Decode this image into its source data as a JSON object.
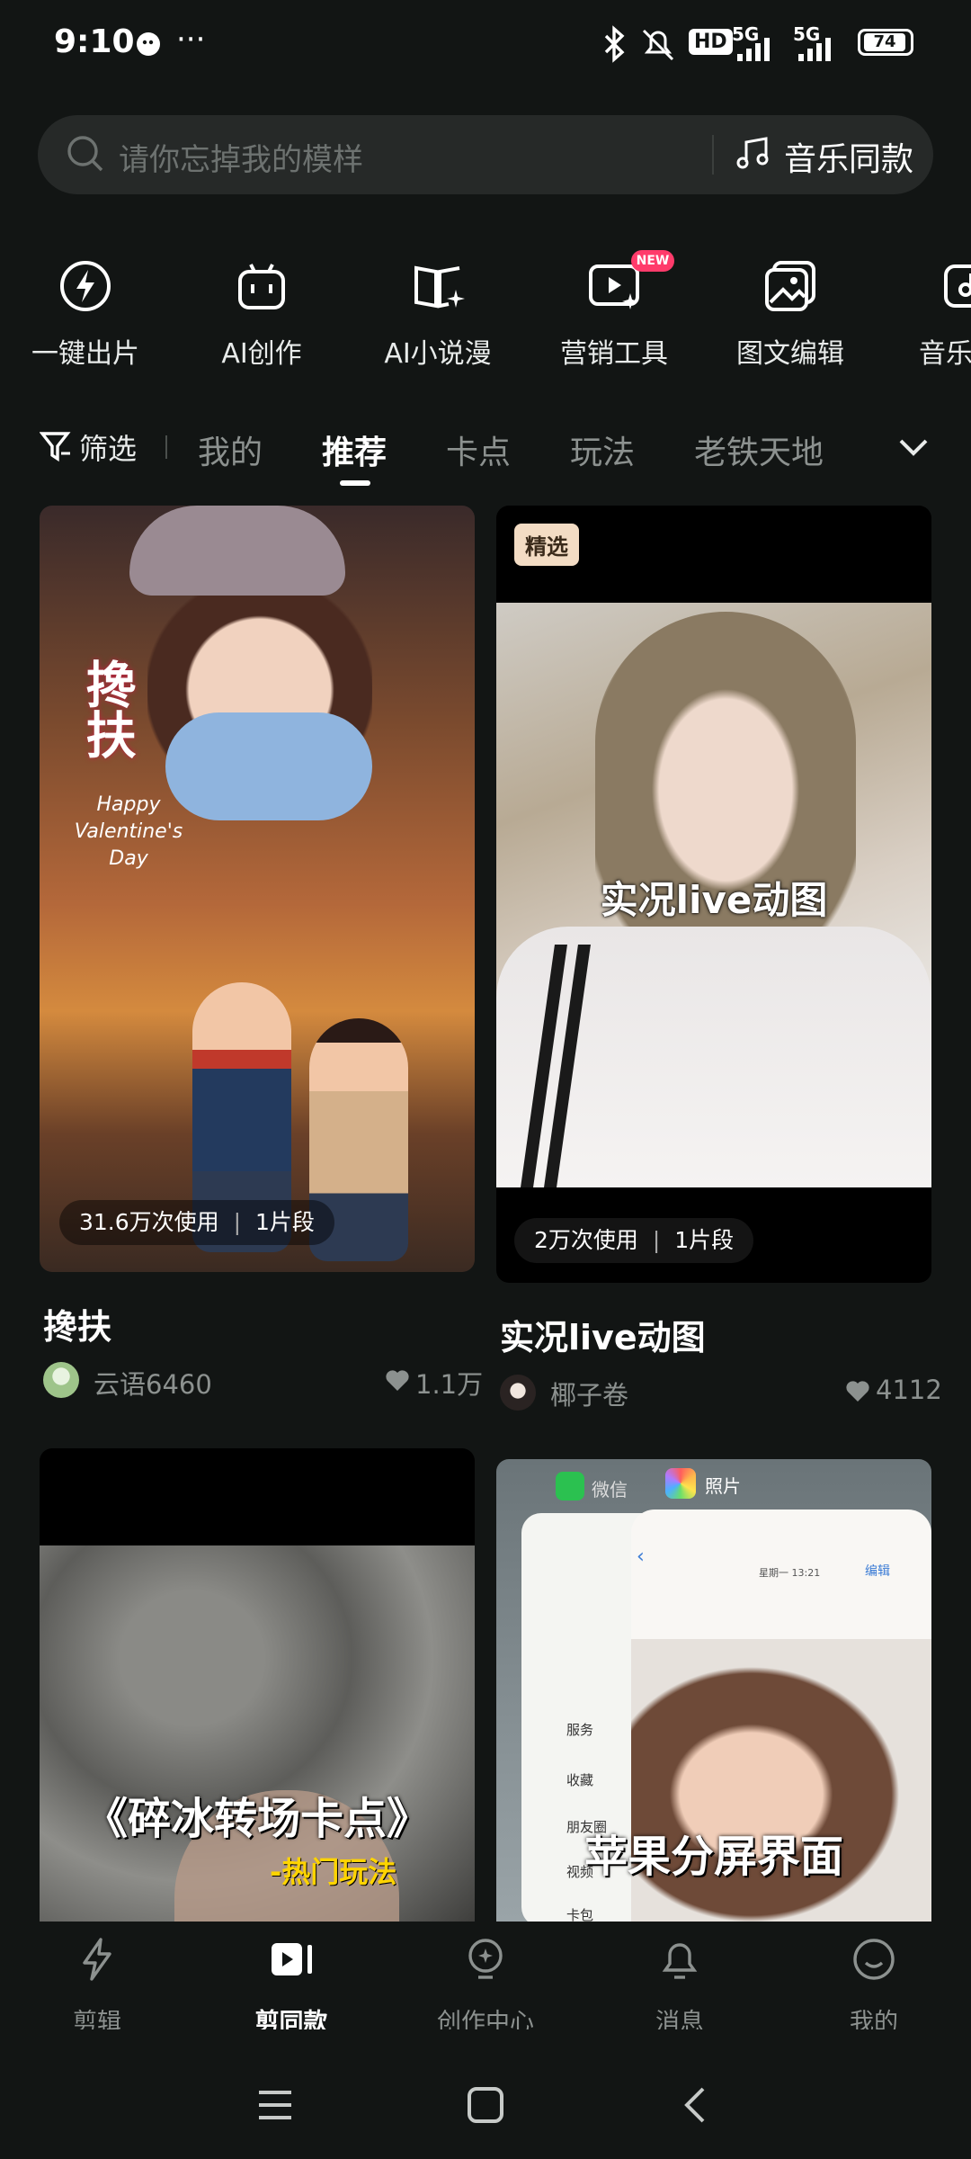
{
  "status_bar": {
    "time": "9:10",
    "more": "···",
    "network_badge": "HD",
    "signal1": "5G",
    "signal2": "5G",
    "battery": "74",
    "icons": [
      "wechat-icon",
      "bluetooth-icon",
      "mute-icon",
      "signal-icon",
      "battery-icon"
    ]
  },
  "search": {
    "placeholder": "请你忘掉我的模样",
    "music_button": "音乐同款"
  },
  "tools": [
    {
      "label": "一键出片",
      "icon": "lightning-icon"
    },
    {
      "label": "AI创作",
      "icon": "robot-icon"
    },
    {
      "label": "AI小说漫",
      "icon": "book-sparkle-icon"
    },
    {
      "label": "营销工具",
      "icon": "video-marketing-icon",
      "badge": "NEW"
    },
    {
      "label": "图文编辑",
      "icon": "image-edit-icon"
    },
    {
      "label": "音乐",
      "icon": "music-icon"
    }
  ],
  "tabs": {
    "filter": "筛选",
    "items": [
      "我的",
      "推荐",
      "卡点",
      "玩法",
      "老铁天地"
    ],
    "active": "推荐"
  },
  "cards": [
    {
      "title": "搀扶",
      "usage": "31.6万次使用",
      "segments": "1片段",
      "author": "云语6460",
      "likes": "1.1万",
      "overlay_text": "搀扶",
      "overlay_sub": "Happy Valentine's Day"
    },
    {
      "title": "实况live动图",
      "usage": "2万次使用",
      "segments": "1片段",
      "author": "椰子卷",
      "likes": "4112",
      "tag": "精选",
      "overlay_text": "实况live动图"
    },
    {
      "overlay_text": "《碎冰转场卡点》",
      "overlay_sub": "-热门玩法"
    },
    {
      "overlay_text": "苹果分屏界面",
      "app1": "微信",
      "app2": "照片",
      "edit": "编辑",
      "date": "星期一 13:21",
      "list": [
        "服务",
        "收藏",
        "朋友圈",
        "视频",
        "卡包"
      ]
    }
  ],
  "bottom_nav": [
    {
      "label": "剪辑",
      "icon": "lightning-outline-icon"
    },
    {
      "label": "剪同款",
      "icon": "template-icon"
    },
    {
      "label": "创作中心",
      "icon": "bulb-icon"
    },
    {
      "label": "消息",
      "icon": "bell-icon"
    },
    {
      "label": "我的",
      "icon": "smile-icon"
    }
  ],
  "colors": {
    "background": "#121514",
    "accent_badge": "#ff3b6b",
    "tag_bg": "#f3dcc4"
  }
}
